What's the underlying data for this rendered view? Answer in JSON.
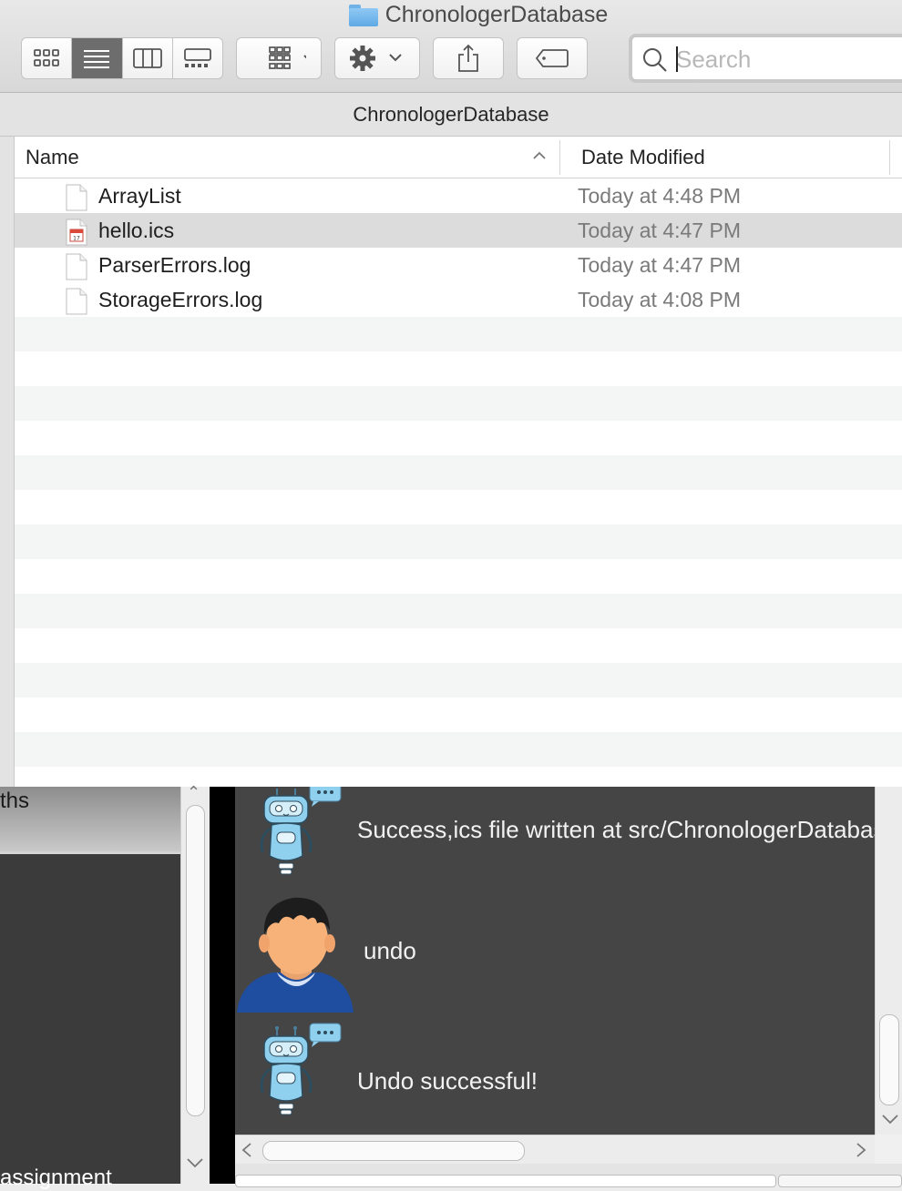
{
  "window": {
    "title": "ChronologerDatabase",
    "path_title": "ChronologerDatabase"
  },
  "toolbar": {
    "view_modes": [
      "icon-view",
      "list-view",
      "column-view",
      "gallery-view"
    ],
    "active_view": "list-view",
    "group_icon": "group-grid-icon",
    "action_icon": "gear-icon",
    "share_icon": "share-icon",
    "tag_icon": "tag-icon"
  },
  "search": {
    "placeholder": "Search",
    "value": ""
  },
  "columns": {
    "name": "Name",
    "date": "Date Modified",
    "sort": "ascending"
  },
  "files": [
    {
      "name": "ArrayList",
      "date": "Today at 4:48 PM",
      "icon": "document-icon",
      "selected": false
    },
    {
      "name": "hello.ics",
      "date": "Today at 4:47 PM",
      "icon": "calendar-file-icon",
      "selected": true
    },
    {
      "name": "ParserErrors.log",
      "date": "Today at 4:47 PM",
      "icon": "document-icon",
      "selected": false
    },
    {
      "name": "StorageErrors.log",
      "date": "Today at 4:08 PM",
      "icon": "document-icon",
      "selected": false
    }
  ],
  "app": {
    "left_fragment_top": "ths",
    "left_fragment_bottom": "assignment",
    "messages": [
      {
        "sender": "bot",
        "text": "Success,ics file written at src/ChronologerDatabase"
      },
      {
        "sender": "user",
        "text": "undo"
      },
      {
        "sender": "bot",
        "text": "Undo successful!"
      }
    ]
  },
  "colors": {
    "chat_bg": "#454545",
    "bot_blue": "#8fd0ee",
    "user_shirt": "#1f4ea0",
    "selected_row": "#dcdcdc"
  }
}
